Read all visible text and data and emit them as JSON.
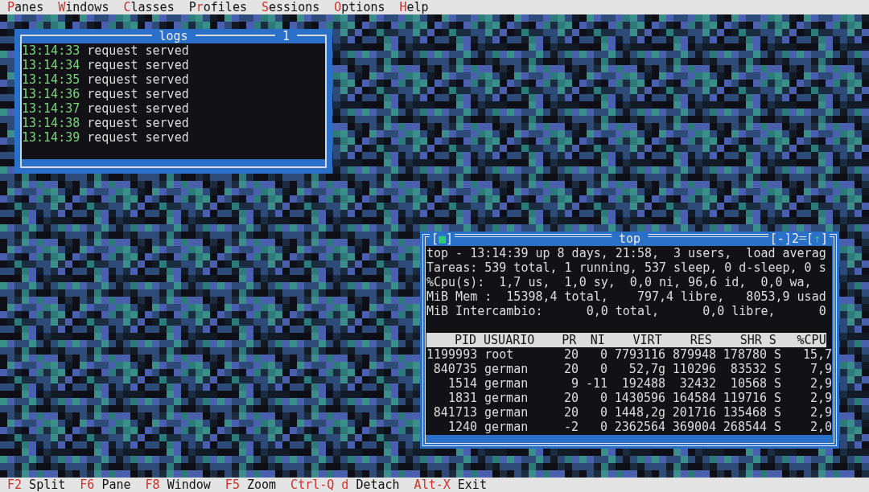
{
  "menu": [
    {
      "label": "**P**anes"
    },
    {
      "label": "**W**indows"
    },
    {
      "label": "**C**lasses"
    },
    {
      "label": "P**r**ofiles"
    },
    {
      "label": "**S**essions"
    },
    {
      "label": "**O**ptions"
    },
    {
      "label": "**H**elp"
    }
  ],
  "logs_window": {
    "title": "logs",
    "number": "1",
    "active": false,
    "lines": [
      {
        "time": "13:14:33",
        "message": "request served"
      },
      {
        "time": "13:14:34",
        "message": "request served"
      },
      {
        "time": "13:14:35",
        "message": "request served"
      },
      {
        "time": "13:14:36",
        "message": "request served"
      },
      {
        "time": "13:14:37",
        "message": "request served"
      },
      {
        "time": "13:14:38",
        "message": "request served"
      },
      {
        "time": "13:14:39",
        "message": "request served"
      }
    ]
  },
  "top_window": {
    "title": "top",
    "number": "2",
    "active": true,
    "close_button": "[■]",
    "zoom_button": "[-]",
    "scroll_button": "[↑]",
    "summary": [
      "top - 13:14:39 up 8 days, 21:58,  3 users,  load averag",
      "Tareas: 539 total, 1 running, 537 sleep, 0 d-sleep, 0 s",
      "%Cpu(s):  1,7 us,  1,0 sy,  0,0 ni, 96,6 id,  0,0 wa,",
      "MiB Mem :  15398,4 total,    797,4 libre,   8053,9 usad",
      "MiB Intercambio:      0,0 total,      0,0 libre,      0"
    ],
    "table": {
      "columns": [
        "PID",
        "USUARIO",
        "PR",
        "NI",
        "VIRT",
        "RES",
        "SHR",
        "S",
        "%CPU"
      ],
      "rows": [
        [
          "1199993",
          "root",
          "20",
          "0",
          "7793116",
          "879948",
          "178780",
          "S",
          "15,7"
        ],
        [
          "840735",
          "german",
          "20",
          "0",
          "52,7g",
          "110296",
          "83532",
          "S",
          "7,9"
        ],
        [
          "1514",
          "german",
          "9",
          "-11",
          "192488",
          "32432",
          "10568",
          "S",
          "2,9"
        ],
        [
          "1831",
          "german",
          "20",
          "0",
          "1430596",
          "164584",
          "119716",
          "S",
          "2,9"
        ],
        [
          "841713",
          "german",
          "20",
          "0",
          "1448,2g",
          "201716",
          "135468",
          "S",
          "2,9"
        ],
        [
          "1240",
          "german",
          "-2",
          "0",
          "2362564",
          "369004",
          "268544",
          "S",
          "2,0"
        ]
      ]
    }
  },
  "status_bar": [
    {
      "key": "F2",
      "label": "Split"
    },
    {
      "key": "F6",
      "label": "Pane"
    },
    {
      "key": "F8",
      "label": "Window"
    },
    {
      "key": "F5",
      "label": "Zoom"
    },
    {
      "key": "Ctrl-Q d",
      "label": "Detach"
    },
    {
      "key": "Alt-X",
      "label": "Exit"
    }
  ]
}
